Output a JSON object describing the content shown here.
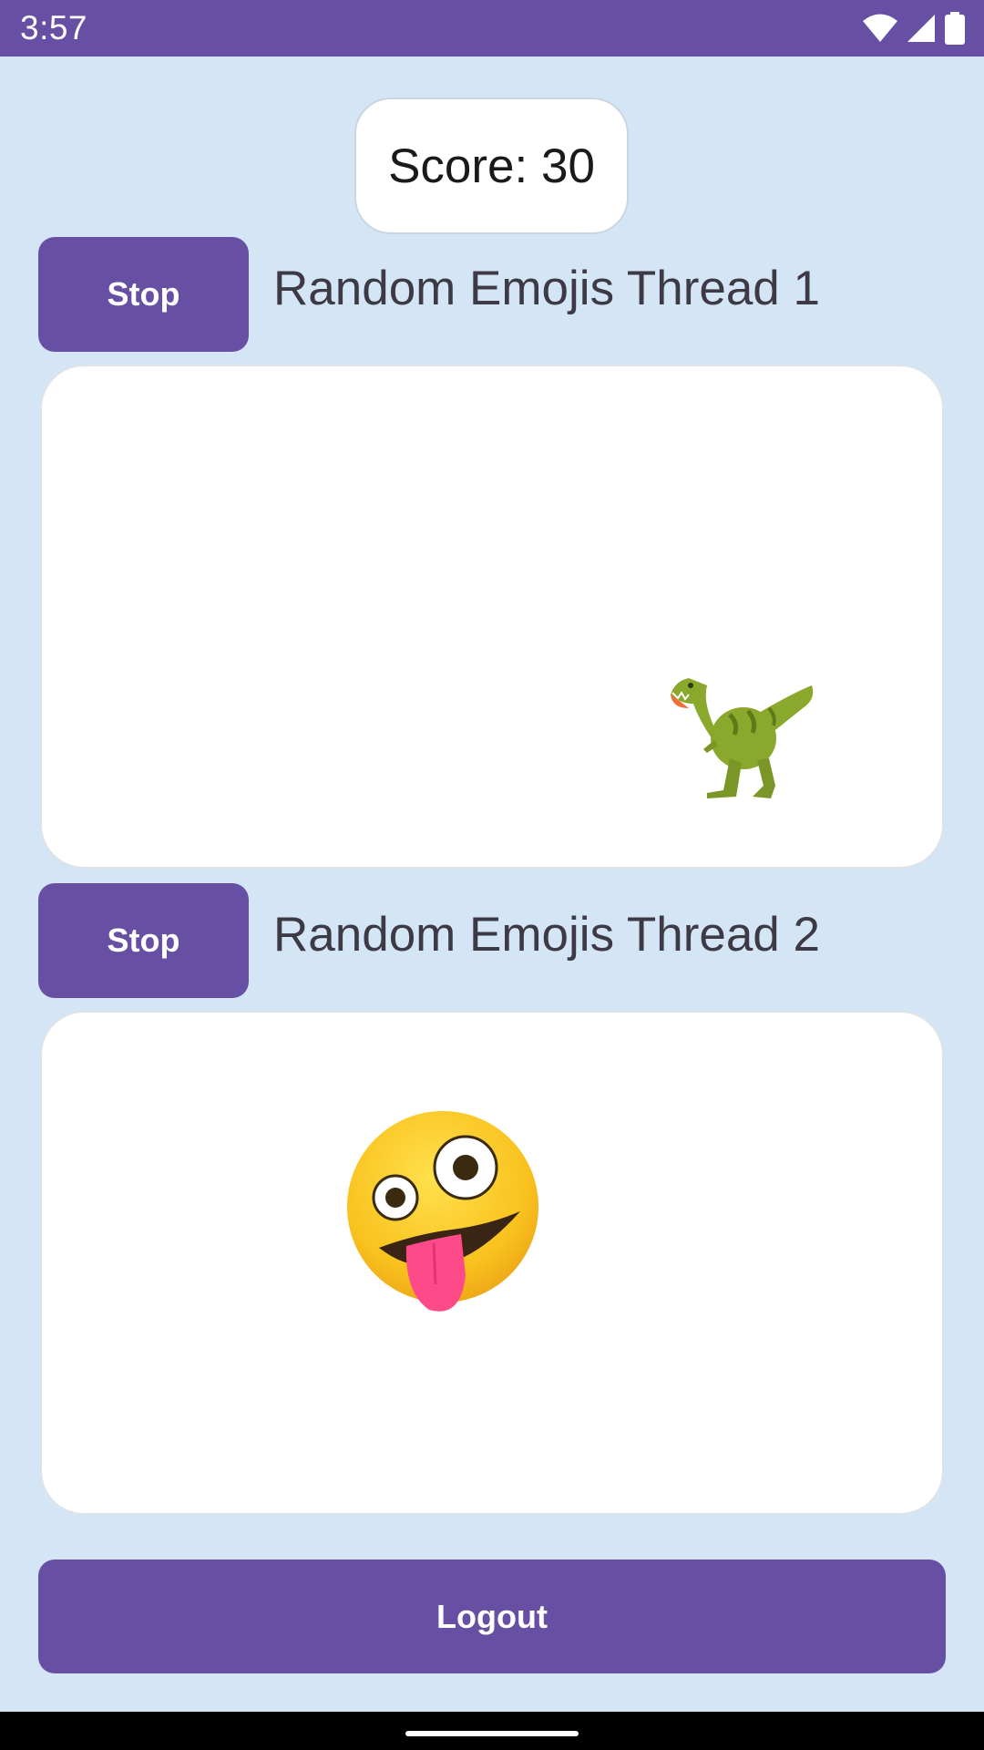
{
  "status_bar": {
    "time": "3:57",
    "icons": [
      "wifi-icon",
      "signal-icon",
      "battery-icon"
    ]
  },
  "score": {
    "label": "Score: 30"
  },
  "threads": [
    {
      "button_label": "Stop",
      "title": "Random Emojis Thread 1",
      "emoji": "t-rex-emoji"
    },
    {
      "button_label": "Stop",
      "title": "Random Emojis Thread 2",
      "emoji": "zany-face-emoji"
    }
  ],
  "logout": {
    "label": "Logout"
  },
  "colors": {
    "primary": "#6750A4",
    "background": "#D4E6F6",
    "panel": "#FFFFFF",
    "title_text": "#3D3A45"
  }
}
